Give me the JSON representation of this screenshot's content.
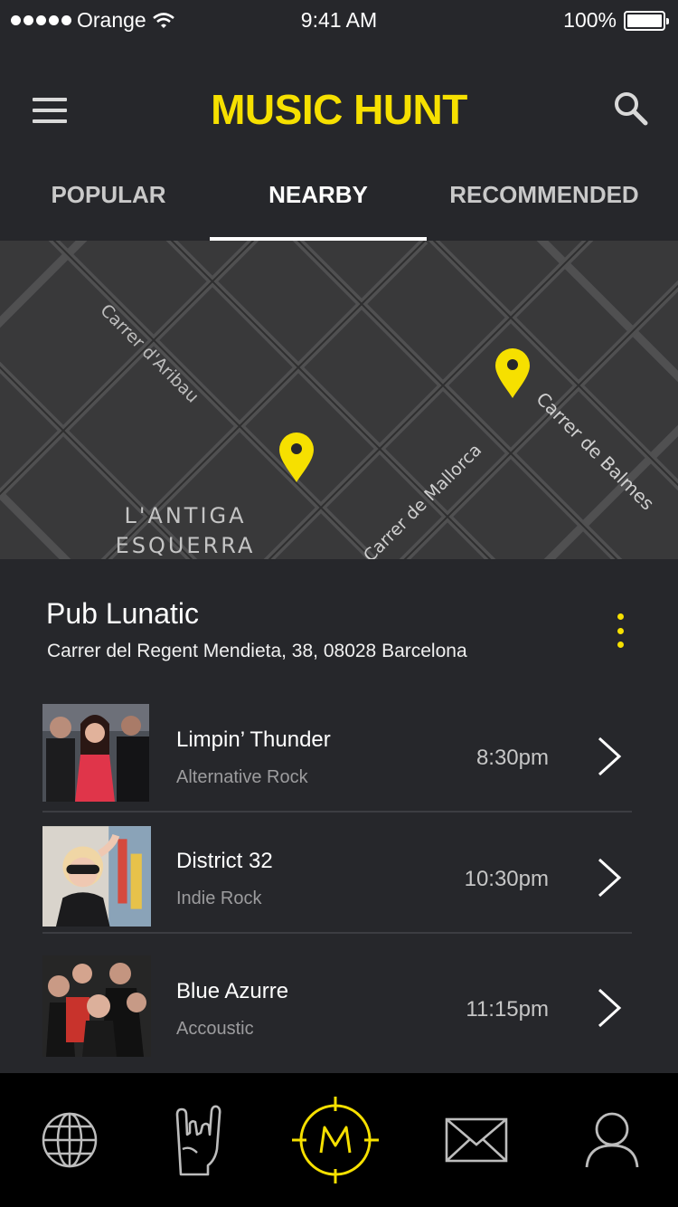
{
  "status_bar": {
    "carrier": "Orange",
    "time": "9:41 AM",
    "battery": "100%"
  },
  "header": {
    "title": "MUSIC HUNT",
    "menu_icon": "hamburger-menu-icon",
    "search_icon": "search-icon"
  },
  "tabs": [
    {
      "label": "POPULAR",
      "active": false
    },
    {
      "label": "NEARBY",
      "active": true
    },
    {
      "label": "RECOMMENDED",
      "active": false
    }
  ],
  "map": {
    "streets": [
      "Carrer d'Aribau",
      "Carrer de Balmes",
      "Carrer de Mallorca"
    ],
    "district": [
      "L'ANTIGA",
      "ESQUERRA"
    ],
    "pin_color": "#f6e000"
  },
  "venue": {
    "name": "Pub Lunatic",
    "address": "Carrer del Regent Mendieta, 38, 08028 Barcelona",
    "events": [
      {
        "name": "Limpin’ Thunder",
        "genre": "Alternative Rock",
        "time": "8:30pm"
      },
      {
        "name": "District 32",
        "genre": "Indie Rock",
        "time": "10:30pm"
      },
      {
        "name": "Blue Azurre",
        "genre": "Accoustic",
        "time": "11:15pm"
      }
    ]
  },
  "bottom_nav": {
    "items": [
      "globe-icon",
      "rock-hand-icon",
      "music-hunt-target-icon",
      "mail-icon",
      "profile-icon"
    ],
    "active_color": "#f6e000"
  }
}
